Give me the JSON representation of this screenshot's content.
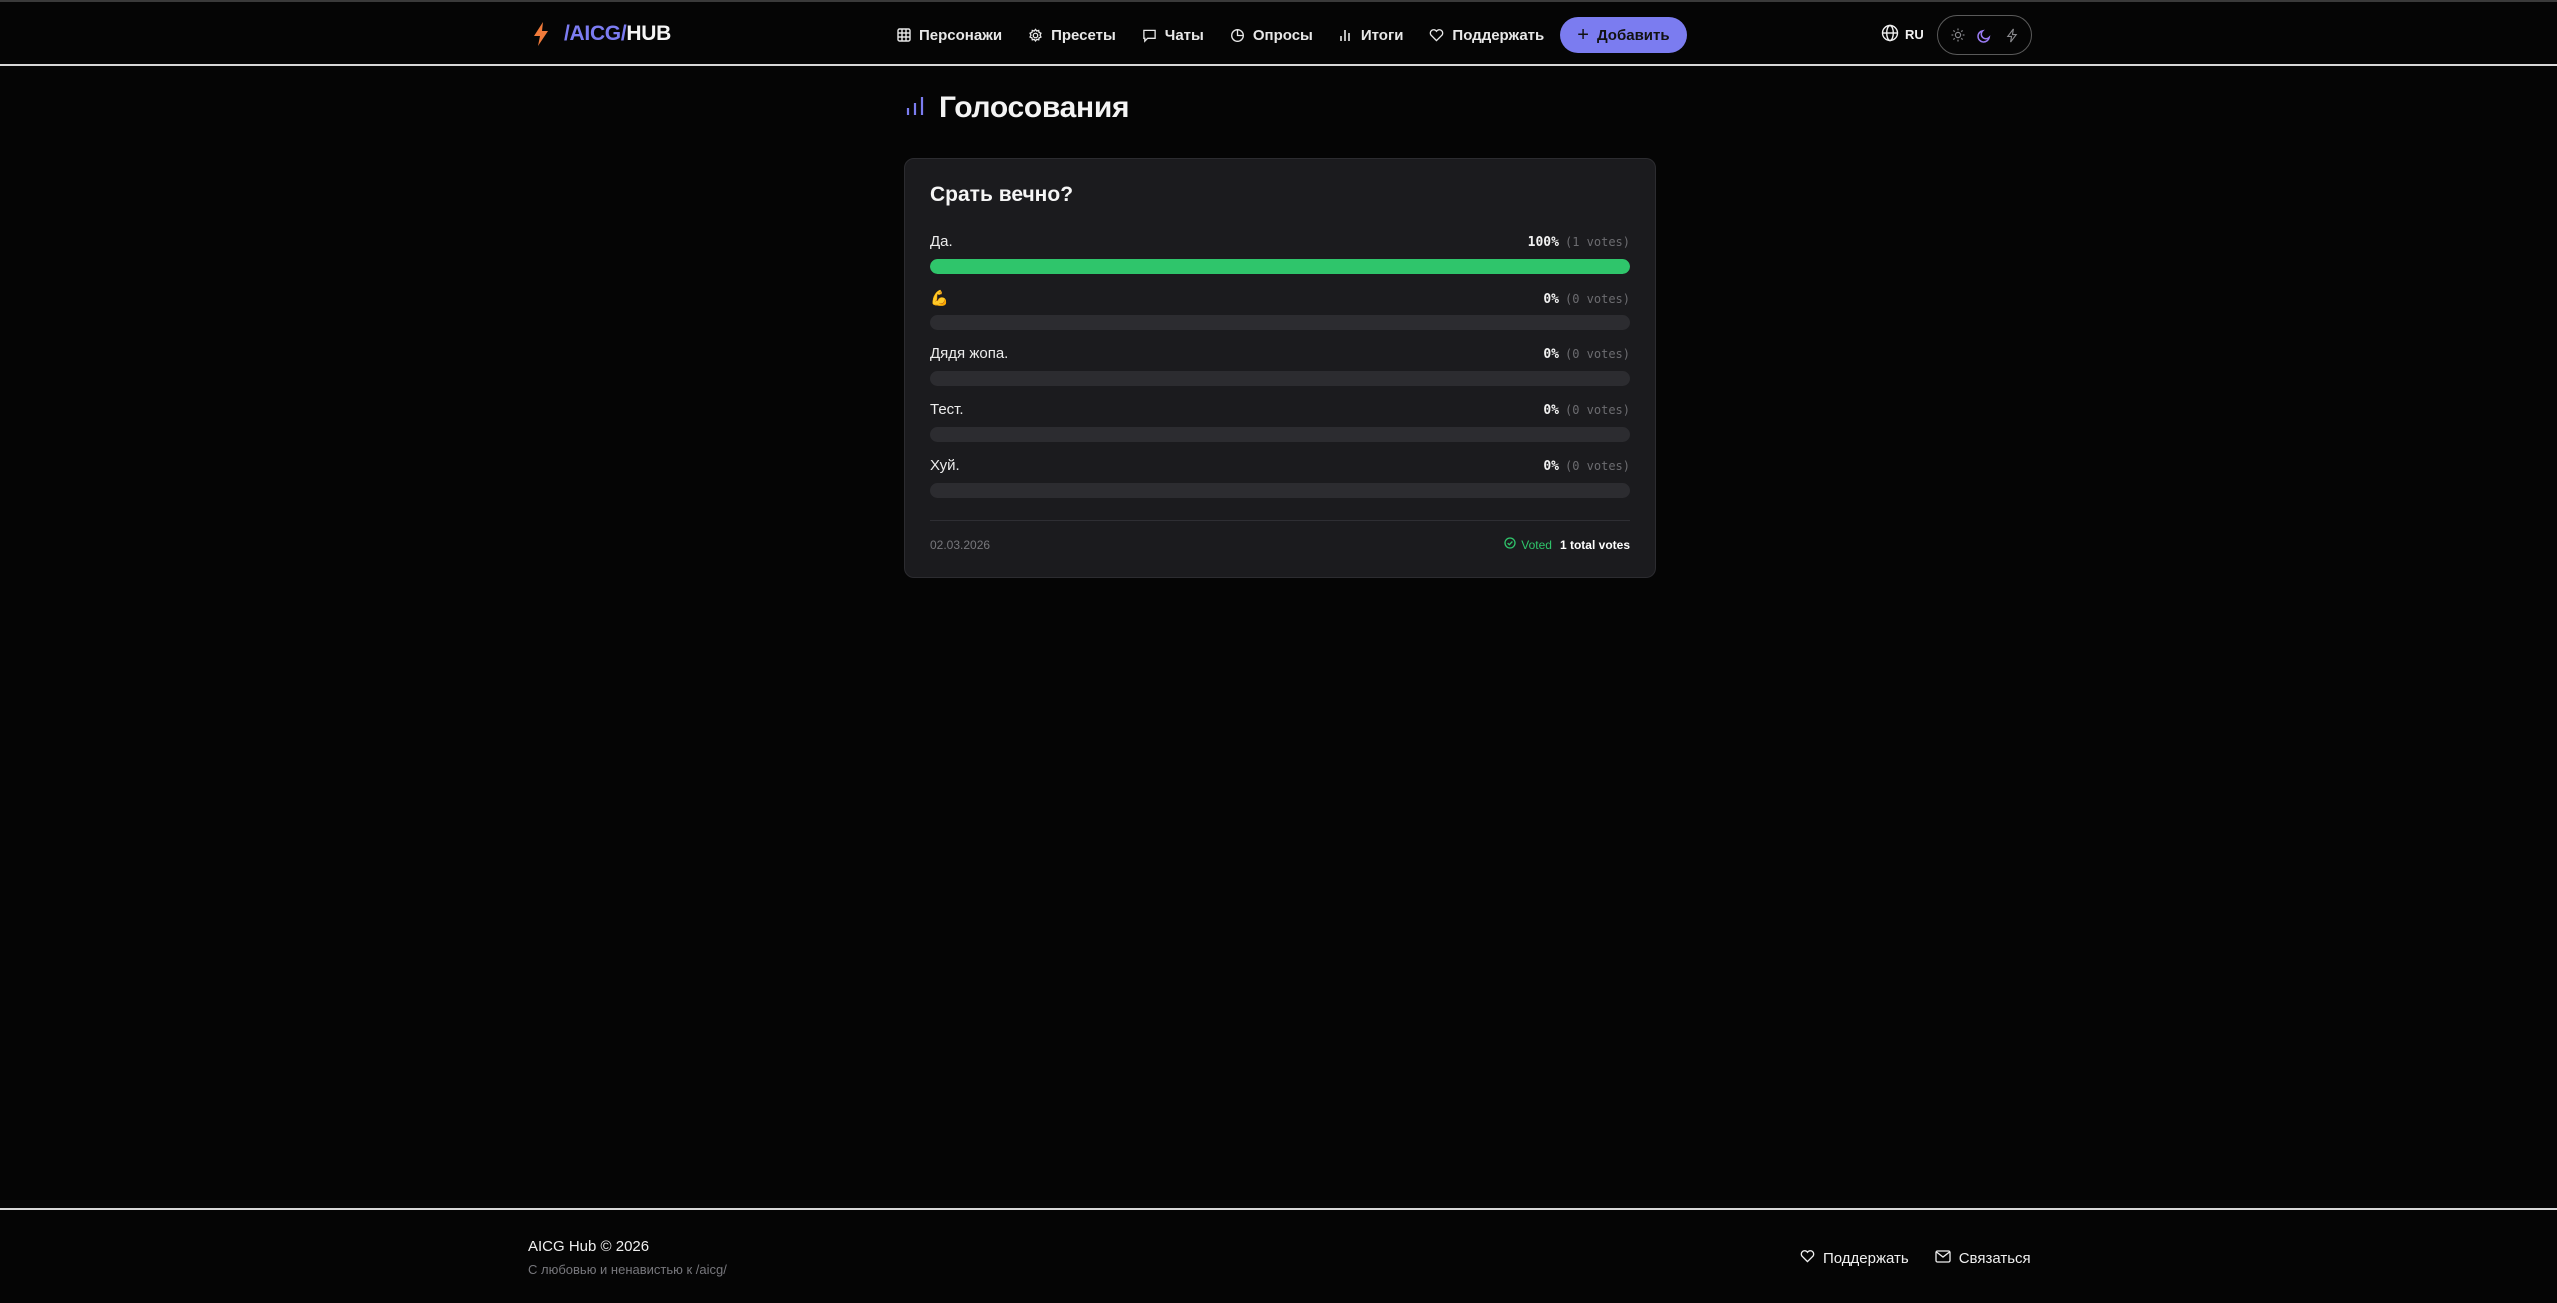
{
  "header": {
    "logo": {
      "slash": "/",
      "aicg": "AICG",
      "slash2": "/",
      "hub": "HUB"
    },
    "nav": [
      {
        "label": "Персонажи",
        "icon": "grid-icon"
      },
      {
        "label": "Пресеты",
        "icon": "gear-icon"
      },
      {
        "label": "Чаты",
        "icon": "chat-icon"
      },
      {
        "label": "Опросы",
        "icon": "pie-chart-icon"
      },
      {
        "label": "Итоги",
        "icon": "bar-chart-icon"
      },
      {
        "label": "Поддержать",
        "icon": "heart-icon"
      }
    ],
    "add_label": "Добавить",
    "lang": "RU",
    "theme_modes": [
      "light",
      "dark",
      "bolt"
    ],
    "active_theme": "dark"
  },
  "page": {
    "title": "Голосования"
  },
  "poll": {
    "question": "Срать вечно?",
    "options": [
      {
        "label": "Да.",
        "percent": "100%",
        "votes": "(1 votes)",
        "fraction": 1.0
      },
      {
        "label": "💪",
        "percent": "0%",
        "votes": "(0 votes)",
        "fraction": 0
      },
      {
        "label": "Дядя жопа.",
        "percent": "0%",
        "votes": "(0 votes)",
        "fraction": 0
      },
      {
        "label": "Тест.",
        "percent": "0%",
        "votes": "(0 votes)",
        "fraction": 0
      },
      {
        "label": "Хуй.",
        "percent": "0%",
        "votes": "(0 votes)",
        "fraction": 0
      }
    ],
    "date": "02.03.2026",
    "voted_label": "Voted",
    "total_label": "1 total votes"
  },
  "footer": {
    "brand": "AICG Hub © 2026",
    "tagline": "С любовью и ненавистью к /aicg/",
    "support_label": "Поддержать",
    "contact_label": "Связаться"
  },
  "colors": {
    "accent": "#7b7cf0",
    "bar_fill": "#2fc56b",
    "bolt": "#f07a3a",
    "background": "#050505",
    "card": "#1b1b1e"
  }
}
